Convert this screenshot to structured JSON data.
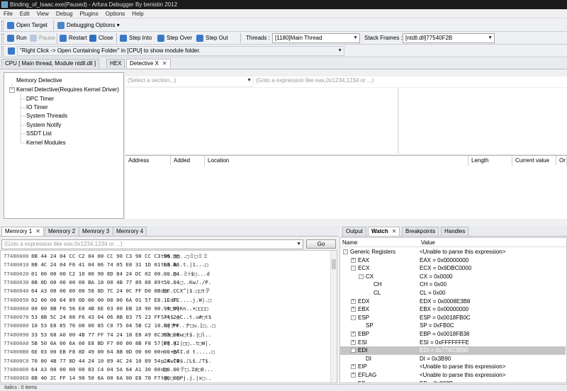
{
  "window": {
    "title": "Binding_of_Isaac.exe(Paused) - Arfura Debugger By benistin 2012"
  },
  "menu": [
    "File",
    "Edit",
    "View",
    "Debug",
    "Plugins",
    "Options",
    "Help"
  ],
  "toolbar1": {
    "open_target": "Open Target",
    "debugging_options": "Debugging Options"
  },
  "toolbar2": {
    "run": "Run",
    "pause": "Pause",
    "restart": "Restart",
    "close": "Close",
    "step_into": "Step Into",
    "step_over": "Step Over",
    "step_out": "Step Out",
    "threads_label": "Threads :",
    "threads_value": "[1180]Main Thread",
    "stack_label": "Stack Frames :",
    "stack_value": "[ntdll.dll]77540F2B"
  },
  "hint": {
    "text": "\"Right Click -> Open Containing Folder\" in [CPU] to show module folder."
  },
  "main_tabs": [
    {
      "label": "CPU [ Main thread, Module ntdll.dll ]"
    },
    {
      "label": "HEX"
    },
    {
      "label": "Detective X"
    }
  ],
  "tree": {
    "root1": "Memory Detective",
    "root2": "Kernel Detective(Requires Kernel Driver)",
    "children": [
      "DPC Timer",
      "IO Timer",
      "System Threads",
      "System Notify",
      "SSDT List",
      "Kernel Modules"
    ]
  },
  "detective": {
    "section_placeholder": "(Select a section...)",
    "expr_placeholder": "(Goto a expression like eax,0x1234,1234 or ...)",
    "columns": [
      "Address",
      "Added",
      "Location",
      "Length",
      "Current value",
      "Or"
    ]
  },
  "memory_tabs": [
    "Memrory 1",
    "Memrory 2",
    "Memrory 3",
    "Memrory 4"
  ],
  "memory": {
    "goto_placeholder": "(Goto a expression like eax,0x1234,1234 or ...)",
    "go_label": "Go",
    "rows": [
      {
        "addr": "77480000",
        "bytes": "8B 44 24 04 CC C2 04 00 CC 90 C3 90 CC C3 90 90",
        "ascii": "tD$.□□..□ミ□ミミ"
      },
      {
        "addr": "77480010",
        "bytes": "8B 4C 24 04 F6 41 04 06 74 05 E8 31 1D 01 00 B8",
        "ascii": "tL$.A..t.|1...□"
      },
      {
        "addr": "77480020",
        "bytes": "01 00 00 00 C2 10 00 90 8D 84 24 DC 02 00 00 64",
        "ascii": "....□..ミﾄ$□...d"
      },
      {
        "addr": "77480030",
        "bytes": "8B 0D 00 00 00 00 BA 10 00 4B 77 89 08 89 50 04",
        "ascii": "t.....□..Kw♪./P."
      },
      {
        "addr": "77480040",
        "bytes": "64 A3 00 00 00 00 58 8D 7C 24 0C FF D0 8B 8F CC",
        "ascii": "d□....X^|$.□□tテ"
      },
      {
        "addr": "77480050",
        "bytes": "02 00 00 64 89 0D 00 00 00 00 6A 01 57 E8 1E FE",
        "ascii": "...d♪.....j.W|.□"
      },
      {
        "addr": "77480060",
        "bytes": "00 00 8B F0 56 E8 4B 6E 03 00 EB 10 90 90 90 90",
        "ascii": "..t□V|Kn..▾□□□□"
      },
      {
        "addr": "77480070",
        "bytes": "53 8B 5C 24 08 F6 43 04 06 8B 03 75 23 FF 74 24",
        "ascii": "S<\\$.□C..t.u#□t$"
      },
      {
        "addr": "77480080",
        "bytes": "10 53 E8 85 76 08 00 85 C0 75 04 5B C2 10 00 FF",
        "ascii": ".S|ナv..ナ□u.[□..□"
      },
      {
        "addr": "77480090",
        "bytes": "33 53 68 A0 00 4B 77 FF 74 24 18 E8 A9 6C 03 00",
        "ascii": "3Sh□.Kw□t$.|□l.."
      },
      {
        "addr": "774800A0",
        "bytes": "5B 50 6A 00 6A 00 E8 BD F7 00 00 8B F8 57 E8 02",
        "ascii": "[Pj.j.|□□..t□W|."
      },
      {
        "addr": "774800B0",
        "bytes": "6E 03 00 EB F8 8D 49 00 64 8B 0D 00 00 00 00 BA",
        "ascii": "n..▾□^I.d t.....□"
      },
      {
        "addr": "774800C0",
        "bytes": "70 00 4B 77 8D 44 24 10 89 4C 24 10 89 54 24 14",
        "ascii": "p.Kw^D$.♪L$.♪T$."
      },
      {
        "addr": "774800D0",
        "bytes": "64 A3 00 00 00 00 83 C4 04 5A 64 A1 30 00 00 00",
        "ascii": "d□....テ□.Zd□0..."
      },
      {
        "addr": "774800E0",
        "bytes": "8B 40 2C FF 14 90 50 6A 00 6A 00 E8 78 F7 00 00",
        "ascii": "t@,□.□Pj.j.|x□.."
      },
      {
        "addr": "774800F0",
        "bytes": "8B F0 56 E8 BD 6D 03 00 EB F8 C2 0C 00 8D 49 00",
        "ascii": "t□V|□m..▾□□..^I."
      },
      {
        "addr": "77480100",
        "bytes": "FC 8B 4C 24 04 8B 1C 24 51 53 E8 5B 68 03 00 0A",
        "ascii": "□tL$.t.$QS|[h..."
      }
    ]
  },
  "bottom_tabs": [
    "Output",
    "Watch",
    "Breakpoints",
    "Handles"
  ],
  "watch": {
    "col_name": "Name",
    "col_value": "Value",
    "rows": [
      {
        "name": "Generic Registers",
        "value": "<Unable to parse this expression>",
        "level": 0,
        "exp": "-"
      },
      {
        "name": "EAX",
        "value": "EAX = 0x00000000",
        "level": 1,
        "exp": "+"
      },
      {
        "name": "ECX",
        "value": "ECX = 0x9DBC0000",
        "level": 1,
        "exp": "-"
      },
      {
        "name": "CX",
        "value": "CX = 0x0000",
        "level": 2,
        "exp": "-"
      },
      {
        "name": "CH",
        "value": "CH = 0x00",
        "level": 3,
        "exp": ""
      },
      {
        "name": "CL",
        "value": "CL = 0x00",
        "level": 3,
        "exp": ""
      },
      {
        "name": "EDX",
        "value": "EDX = 0x0008E3B8",
        "level": 1,
        "exp": "+"
      },
      {
        "name": "EBX",
        "value": "EBX = 0x00000000",
        "level": 1,
        "exp": "+"
      },
      {
        "name": "ESP",
        "value": "ESP = 0x0018FB0C",
        "level": 1,
        "exp": "-"
      },
      {
        "name": "SP",
        "value": "SP = 0xFB0C",
        "level": 2,
        "exp": ""
      },
      {
        "name": "EBP",
        "value": "EBP = 0x0018FB38",
        "level": 1,
        "exp": "+"
      },
      {
        "name": "ESI",
        "value": "ESI = 0xFFFFFFFE",
        "level": 1,
        "exp": "+"
      },
      {
        "name": "EDI",
        "value": "EDI = 0x774C3B90",
        "level": 1,
        "exp": "-",
        "selected": true
      },
      {
        "name": "DI",
        "value": "DI = 0x3B90",
        "level": 2,
        "exp": ""
      },
      {
        "name": "EIP",
        "value": "<Unable to parse this expression>",
        "level": 1,
        "exp": "+"
      },
      {
        "name": "EFLAG",
        "value": "<Unable to parse this expression>",
        "level": 1,
        "exp": "+"
      },
      {
        "name": "ES",
        "value": "ES = 0x002B",
        "level": 1,
        "exp": ""
      },
      {
        "name": "CS",
        "value": "CS = 0x0023",
        "level": 1,
        "exp": ""
      },
      {
        "name": "SS",
        "value": "SS = 0x002B",
        "level": 1,
        "exp": ""
      }
    ]
  },
  "status": {
    "text": "Italics : 0 items"
  }
}
